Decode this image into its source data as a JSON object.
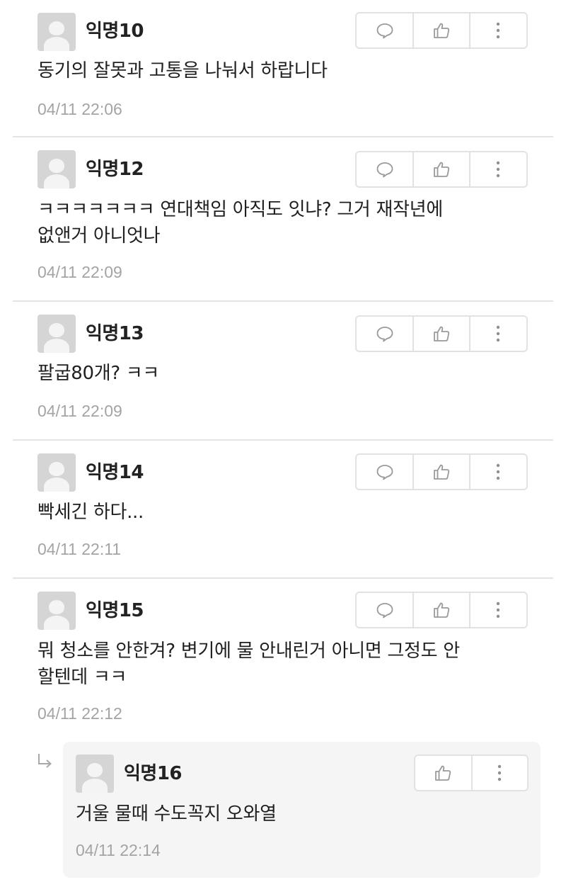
{
  "comments": [
    {
      "author": "익명10",
      "lines": [
        "동기의 잘못과 고통을 나눠서 하랍니다"
      ],
      "time": "04/11 22:06"
    },
    {
      "author": "익명12",
      "lines": [
        "ㅋㅋㅋㅋㅋㅋㅋ 연대책임 아직도 잇냐? 그거 재작년에",
        "없앤거 아니엇나"
      ],
      "time": "04/11 22:09"
    },
    {
      "author": "익명13",
      "lines": [
        "팔굽80개? ㅋㅋ"
      ],
      "time": "04/11 22:09"
    },
    {
      "author": "익명14",
      "lines": [
        "빡세긴 하다..."
      ],
      "time": "04/11 22:11"
    },
    {
      "author": "익명15",
      "lines": [
        "뭐 청소를 안한겨? 변기에 물 안내린거 아니면 그정도 안",
        "할텐데 ㅋㅋ"
      ],
      "time": "04/11 22:12"
    }
  ],
  "reply": {
    "author": "익명16",
    "lines": [
      "거울 물때 수도꼭지 오와열"
    ],
    "time": "04/11 22:14"
  },
  "icons": {
    "comment": "speech-bubble-icon",
    "like": "thumbs-up-icon",
    "more": "more-vertical-icon",
    "reply": "reply-arrow-icon"
  },
  "colors": {
    "text": "#1f1f1f",
    "timestamp": "#a4a4a4",
    "border": "#e2e2e2",
    "reply_bg": "#f5f5f5"
  }
}
